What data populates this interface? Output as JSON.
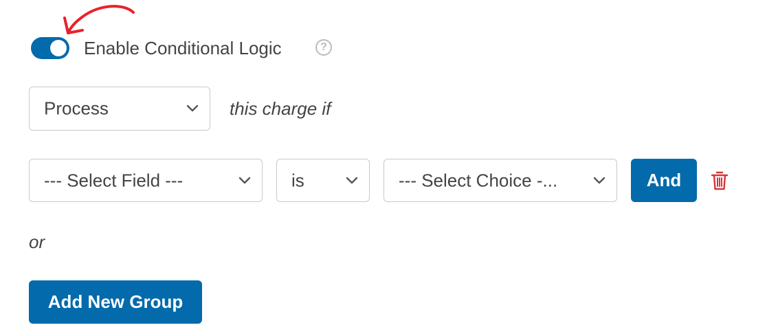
{
  "toggle": {
    "label": "Enable Conditional Logic",
    "enabled": true,
    "accent_color": "#036aab",
    "help_icon": "question-circle-icon"
  },
  "annotation": {
    "icon": "curved-arrow-icon",
    "color": "#e8222a"
  },
  "condition_header": {
    "action_select": "Process",
    "suffix_text": "this charge if"
  },
  "rule": {
    "field_select": "--- Select Field ---",
    "operator_select": "is",
    "choice_select": "--- Select Choice -...",
    "and_button": "And",
    "delete_icon": "trash-icon",
    "delete_color": "#d63638"
  },
  "or_text": "or",
  "add_group_button": "Add New Group"
}
